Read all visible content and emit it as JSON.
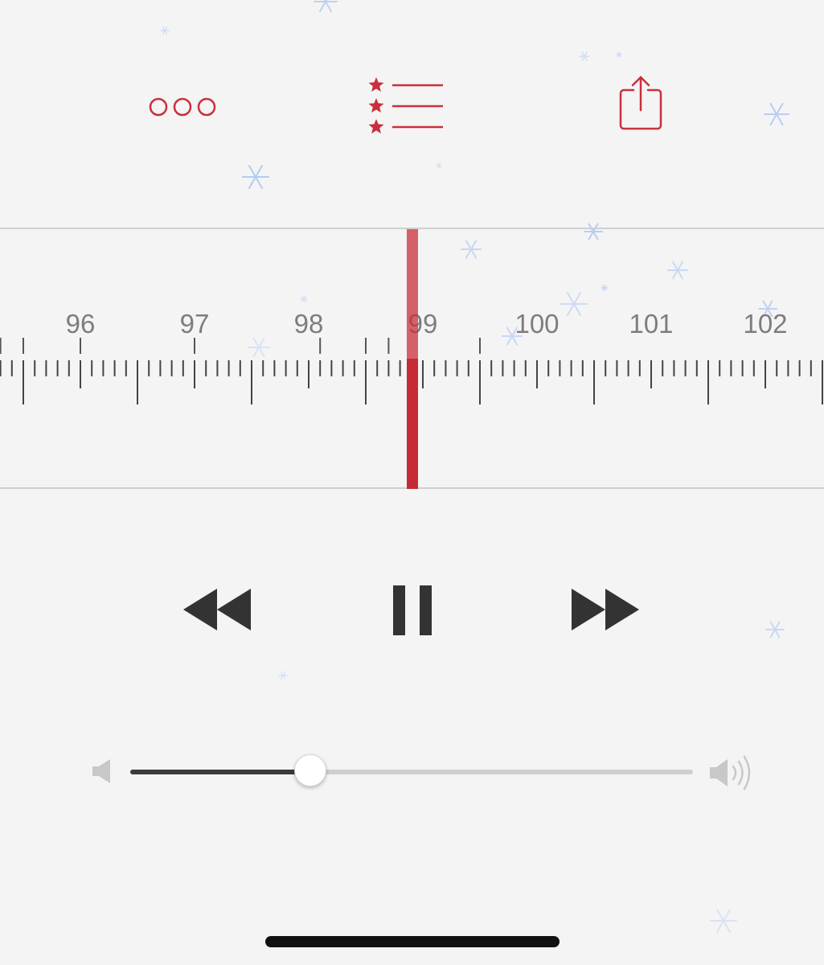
{
  "colors": {
    "accent": "#c9303c",
    "background": "#f4f4f4",
    "control": "#333333",
    "label": "#7d7d7d",
    "snow": "#a9c4f2"
  },
  "toolbar": {
    "more_icon": "more-horizontal-icon",
    "favorites_icon": "starred-list-icon",
    "share_icon": "share-icon"
  },
  "tuner": {
    "scale_labels": [
      "96",
      "97",
      "98",
      "99",
      "100",
      "101",
      "102"
    ],
    "current_frequency": 98.9
  },
  "transport": {
    "rewind_icon": "rewind-icon",
    "pause_icon": "pause-icon",
    "forward_icon": "fast-forward-icon"
  },
  "volume": {
    "level": 0.32,
    "min_icon": "speaker-low-icon",
    "max_icon": "speaker-high-icon"
  }
}
